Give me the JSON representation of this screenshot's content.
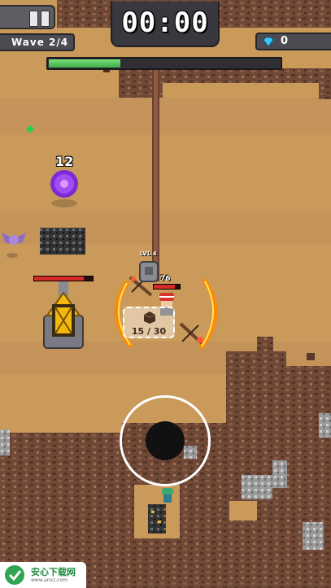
{
  "hud": {
    "wave_label": "Wave 2/4",
    "timer": "00:00",
    "gem_count": "0",
    "wave_progress": 0.31
  },
  "player": {
    "level_label": "LVL 4",
    "hp_value": "76",
    "hp_fraction": 0.8
  },
  "enemy": {
    "damage_text": "12"
  },
  "tower": {
    "hp_fraction": 0.85
  },
  "crate": {
    "capacity_label": "15 / 30"
  },
  "watermark": {
    "title": "安心下载网",
    "url": "www.anxz.com"
  },
  "colors": {
    "sand": "#c99a5a",
    "rock": "#6b4534",
    "progress_fill": "#4cc25a",
    "gem": "#3ec7ff",
    "flame": "#ff8a00"
  },
  "icons": [
    "pause-icon",
    "gem-icon",
    "joystick",
    "crossbow-icon",
    "bat-icon",
    "portal-icon",
    "tower-icon",
    "player-icon",
    "crate-icon"
  ]
}
